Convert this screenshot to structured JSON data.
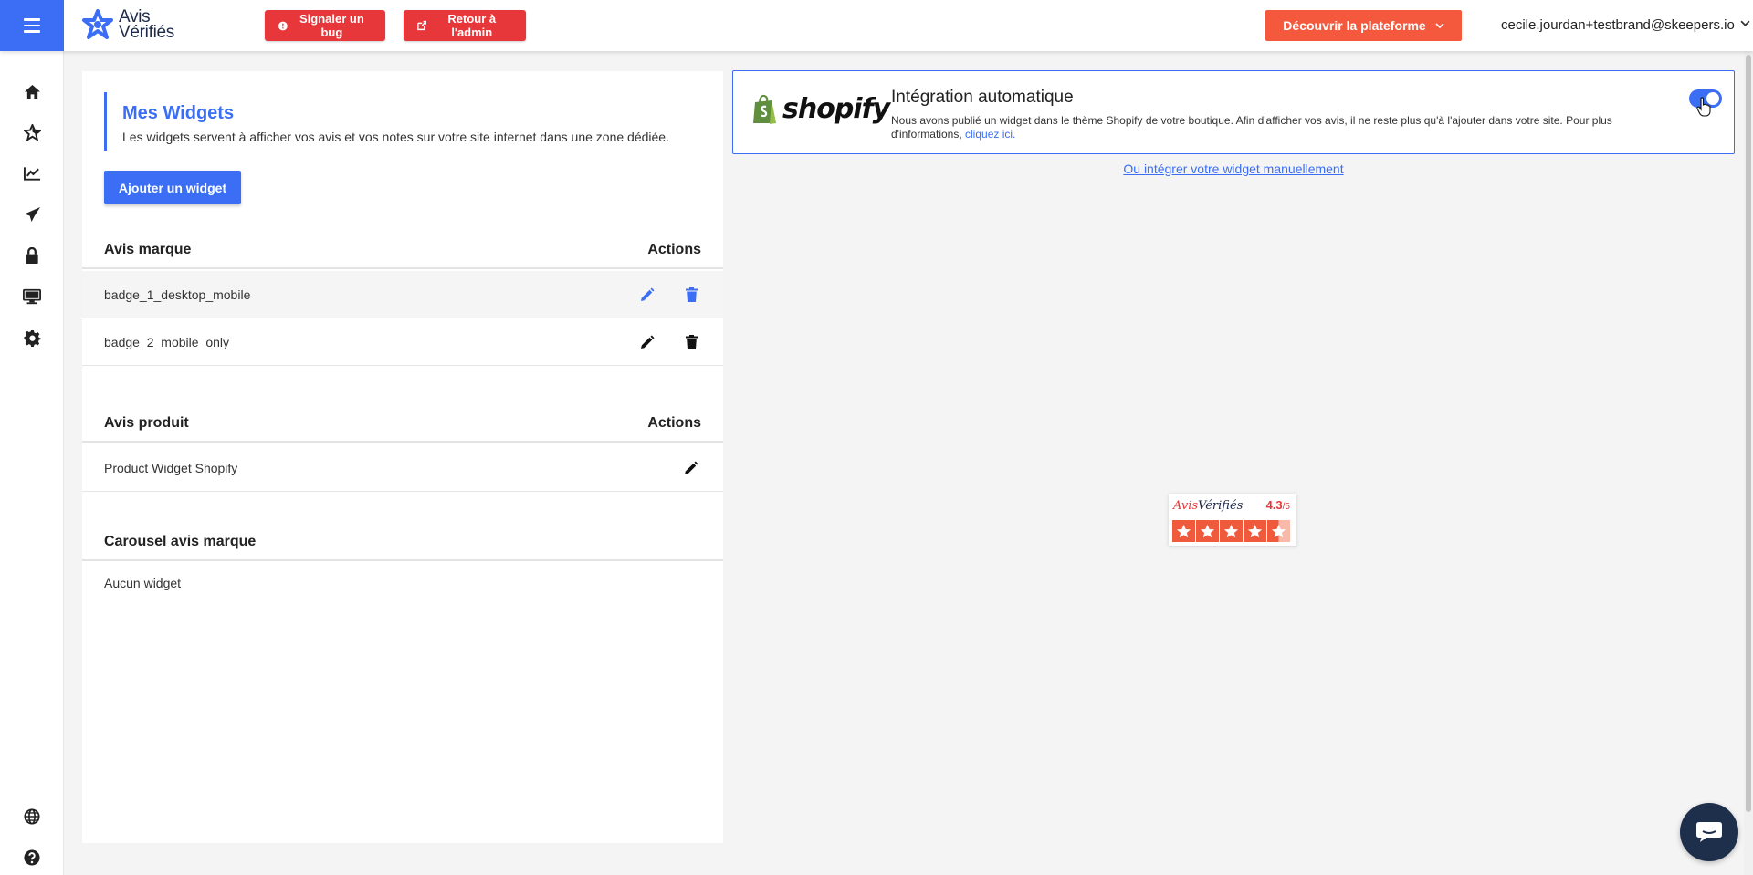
{
  "header": {
    "logo_line1": "Avis",
    "logo_line2": "Vérifiés",
    "bug_button": "Signaler un bug",
    "admin_button": "Retour à l'admin",
    "discover_button": "Découvrir la plateforme",
    "user_email": "cecile.jourdan+testbrand@skeepers.io"
  },
  "sidebar": {
    "items": [
      {
        "icon": "home-icon"
      },
      {
        "icon": "star-icon"
      },
      {
        "icon": "chart-icon"
      },
      {
        "icon": "paper-plane-icon"
      },
      {
        "icon": "lock-icon"
      },
      {
        "icon": "desktop-icon"
      },
      {
        "icon": "gear-icon"
      },
      {
        "icon": "globe-icon"
      },
      {
        "icon": "help-icon"
      }
    ]
  },
  "widgets": {
    "title": "Mes Widgets",
    "description": "Les widgets servent à afficher vos avis et vos notes sur votre site internet dans une zone dédiée.",
    "add_button": "Ajouter un widget",
    "sections": [
      {
        "title": "Avis marque",
        "actions_label": "Actions",
        "rows": [
          {
            "name": "badge_1_desktop_mobile"
          },
          {
            "name": "badge_2_mobile_only"
          }
        ]
      },
      {
        "title": "Avis produit",
        "actions_label": "Actions",
        "rows": [
          {
            "name": "Product Widget Shopify"
          }
        ]
      },
      {
        "title": "Carousel avis marque",
        "empty_text": "Aucun widget"
      }
    ]
  },
  "shopify": {
    "logo_text": "shopify",
    "title": "Intégration automatique",
    "description": "Nous avons publié un widget dans le thème Shopify de votre boutique. Afin d'afficher vos avis, il ne reste plus qu'à l'ajouter dans votre site. Pour plus d'informations,",
    "link": "cliquez ici.",
    "toggle_on": true,
    "manual_link": "Ou intégrer votre widget manuellement"
  },
  "preview_badge": {
    "brand_part1": "Avis",
    "brand_part2": "Vérifiés",
    "score": "4.3",
    "score_max": "/5",
    "rating": 4.3,
    "colors": {
      "star": "#f05a3c",
      "star_light": "#f8b9aa"
    }
  },
  "colors": {
    "primary": "#3b6ef5",
    "danger": "#e8373b",
    "orange": "#f4593e",
    "chat": "#1e2f4b"
  }
}
